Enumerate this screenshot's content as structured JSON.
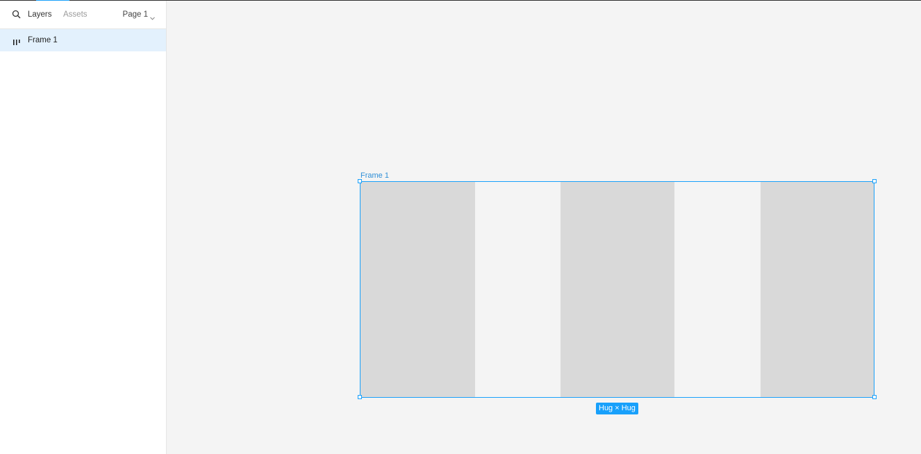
{
  "header": {
    "search_icon": "search-icon",
    "tabs": [
      {
        "label": "Layers",
        "active": true
      },
      {
        "label": "Assets",
        "active": false
      }
    ],
    "page_select": {
      "label": "Page 1",
      "icon": "chevron-down-icon"
    }
  },
  "layers": [
    {
      "label": "Frame 1",
      "icon": "auto-layout-frame-icon",
      "selected": true
    }
  ],
  "canvas": {
    "frame": {
      "label": "Frame 1",
      "size_badge": "Hug × Hug"
    }
  },
  "colors": {
    "accent": "#18a0fb",
    "selected_row": "#e3f1fd",
    "canvas_bg": "#f4f4f4",
    "rect_fill": "#d9d9d9"
  }
}
